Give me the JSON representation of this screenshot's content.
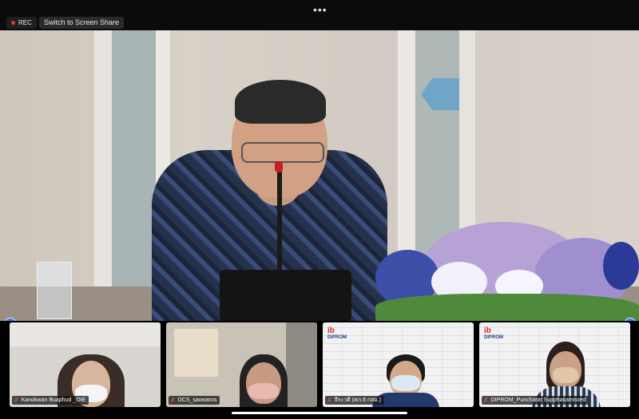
{
  "topbar": {
    "menu_dots": "•••",
    "rec_label": "REC",
    "share_label": "Switch to Screen Share"
  },
  "participants": [
    {
      "name": "Kanokwan Buaphud _OIE"
    },
    {
      "name": "DCS_saowaros"
    },
    {
      "name": "จีระวดี (ศภ.6 กสอ.)"
    },
    {
      "name": "DIPROM_Puncharat Supphakamnoed"
    }
  ],
  "logos": {
    "mark": "ib",
    "text": "DIPROM"
  },
  "controls": {
    "left_icon": "user-icon",
    "right_icon": "minus-icon"
  },
  "colors": {
    "rec_dot": "#e5322d",
    "accent": "#3b82f6",
    "mute": "#ff4d4d"
  }
}
